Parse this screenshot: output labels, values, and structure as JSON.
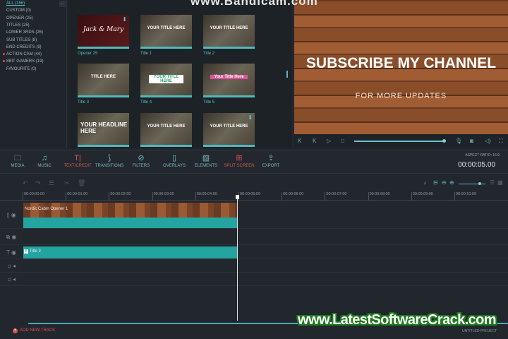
{
  "sidebar": {
    "collapse_icon": "arrow-left",
    "categories": [
      {
        "label": "ALL (156)",
        "active": true
      },
      {
        "label": "CUSTOM (0)"
      },
      {
        "label": "OPENER (25)"
      },
      {
        "label": "TITLES (25)"
      },
      {
        "label": "LOWER 3RDS (26)"
      },
      {
        "label": "SUB TITLES (8)"
      },
      {
        "label": "END CREDITS (9)"
      },
      {
        "label": "ACTION CAM (44)",
        "dot": true
      },
      {
        "label": "8BIT GAMERS (19)",
        "dot": true
      },
      {
        "label": "FAVOURITE (0)"
      }
    ]
  },
  "grid": {
    "items": [
      {
        "label": "Opener 25",
        "text": "Jack & Mary"
      },
      {
        "label": "Title 1",
        "text": "YOUR TITLE HERE"
      },
      {
        "label": "Title 2",
        "text": "YOUR TITLE HERE"
      },
      {
        "label": "Title 3",
        "text": "TITLE HERE"
      },
      {
        "label": "Title 4",
        "text": "YOUR TITLE HERE"
      },
      {
        "label": "Title 5",
        "text": "Your Title Here"
      },
      {
        "label": "",
        "text": "YOUR HEADLINE HERE"
      },
      {
        "label": "",
        "text": "YOUR TITLE HERE"
      },
      {
        "label": "",
        "text": "YOUR TITLE HERE"
      }
    ]
  },
  "watermark_top": "www.Bandicam.com",
  "preview": {
    "headline": "SUBSCRIBE MY CHANNEL",
    "subline": "FOR MORE UPDATES",
    "progress": 1.0
  },
  "toolbar": {
    "items": [
      "MEDIA",
      "MUSIC",
      "TEXT/CREDIT",
      "TRANSITIONS",
      "FILTERS",
      "OVERLAYS",
      "ELEMENTS",
      "SPLIT SCREEN",
      "EXPORT"
    ],
    "aspect_ratio": "ASPECT RATIO: 16:9",
    "timecode": "00:00:05.00"
  },
  "ruler": [
    "00:00:00:00",
    "00:00:01:00",
    "00:00:02:00",
    "00:00:03:00",
    "00:00:04:00",
    "00:00:05:00",
    "00:00:06:00",
    "00:00:07:00",
    "00:00:08:00",
    "00:00:09:00",
    "00:00:10:00"
  ],
  "timeline": {
    "video_clip": "Nordic Cabin Opener 1",
    "title_clip": "Title 2",
    "add_track": "ADD NEW TRACK",
    "project": "UNTITLED PROJECT"
  },
  "watermark_bottom": "www.LatestSoftwareCrack.com"
}
